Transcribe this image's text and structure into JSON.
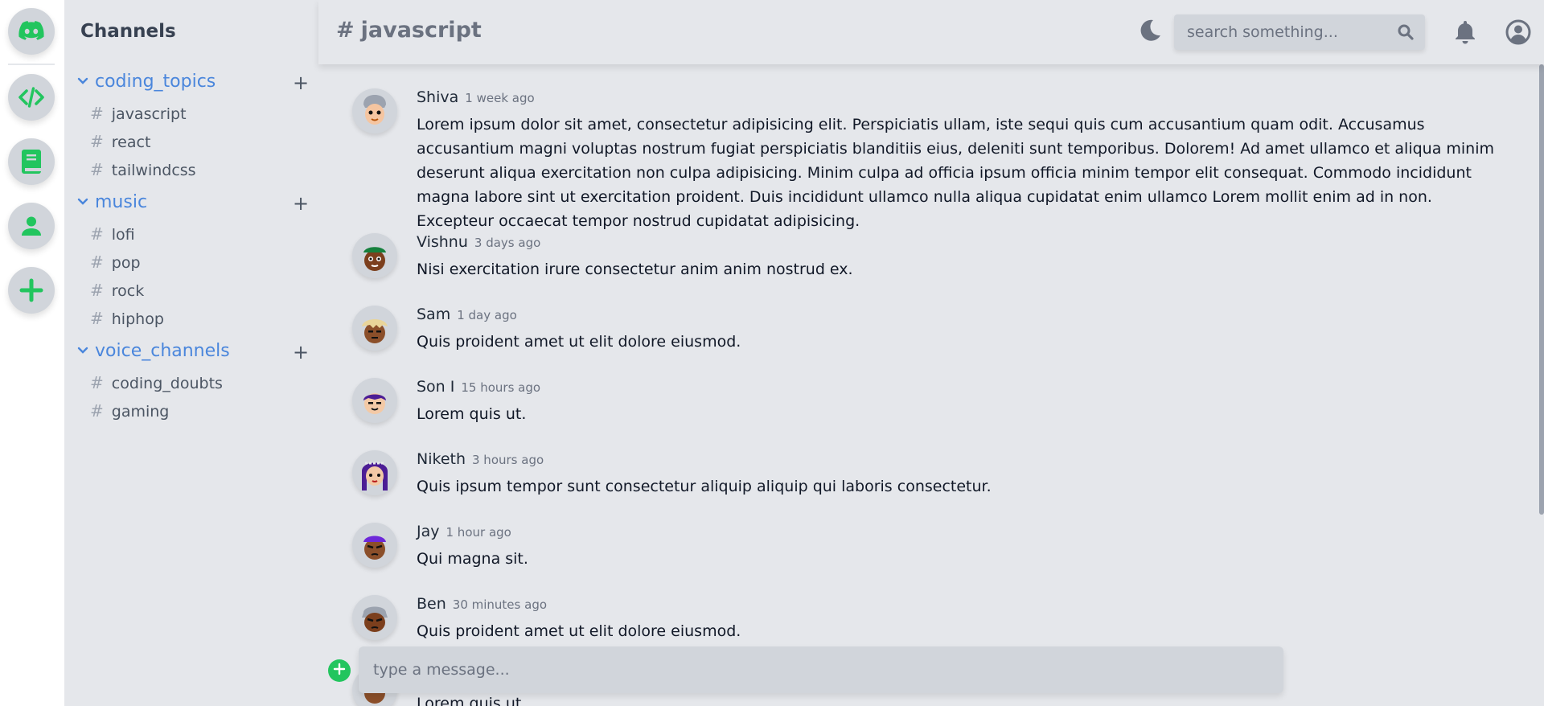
{
  "sidebar": {
    "title": "Channels",
    "groups": [
      {
        "name": "coding_topics",
        "add": "+",
        "channels": [
          "javascript",
          "react",
          "tailwindcss"
        ]
      },
      {
        "name": "music",
        "add": "+",
        "channels": [
          "lofi",
          "pop",
          "rock",
          "hiphop"
        ]
      },
      {
        "name": "voice_channels",
        "add": "+",
        "channels": [
          "coding_doubts",
          "gaming"
        ]
      }
    ],
    "hash": "#"
  },
  "rail": {
    "icons": [
      "discord-icon",
      "code-icon",
      "book-icon",
      "user-icon",
      "plus-icon"
    ]
  },
  "header": {
    "hash": "#",
    "channel": "javascript",
    "search_placeholder": "search something..."
  },
  "messages": [
    {
      "author": "Shiva",
      "time": "1 week ago",
      "text": "Lorem ipsum dolor sit amet, consectetur adipisicing elit. Perspiciatis ullam, iste sequi quis cum accusantium quam odit. Accusamus accusantium magni voluptas nostrum fugiat perspiciatis blanditiis eius, deleniti sunt temporibus. Dolorem! Ad amet ullamco et aliqua minim deserunt aliqua exercitation non culpa adipisicing. Minim culpa ad officia ipsum officia minim tempor elit consequat. Commodo incididunt magna labore sint ut exercitation proident. Duis incididunt ullamco nulla aliqua cupidatat enim ullamco Lorem mollit enim ad in non. Excepteur occaecat tempor nostrud cupidatat adipisicing."
    },
    {
      "author": "Vishnu",
      "time": "3 days ago",
      "text": "Nisi exercitation irure consectetur anim anim nostrud ex."
    },
    {
      "author": "Sam",
      "time": "1 day ago",
      "text": "Quis proident amet ut elit dolore eiusmod."
    },
    {
      "author": "Son I",
      "time": "15 hours ago",
      "text": "Lorem quis ut."
    },
    {
      "author": "Niketh",
      "time": "3 hours ago",
      "text": "Quis ipsum tempor sunt consectetur aliquip aliquip qui laboris consectetur."
    },
    {
      "author": "Jay",
      "time": "1 hour ago",
      "text": "Qui magna sit."
    },
    {
      "author": "Ben",
      "time": "30 minutes ago",
      "text": "Quis proident amet ut elit dolore eiusmod."
    },
    {
      "author": "",
      "time": "",
      "text": "Lorem quis ut."
    }
  ],
  "composer": {
    "placeholder": "type a message..."
  },
  "colors": {
    "accent_green": "#22c55e",
    "group_blue": "#4a86dc"
  }
}
